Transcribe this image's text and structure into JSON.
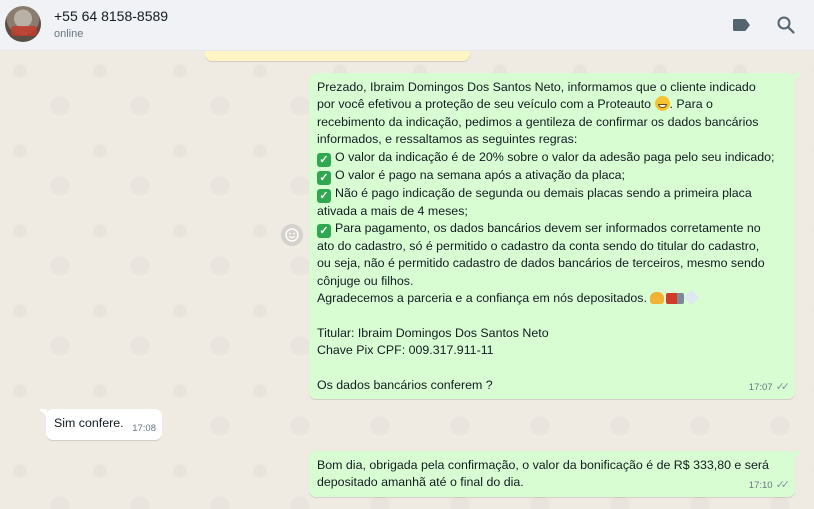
{
  "contact": {
    "name": "+55 64 8158-8589",
    "status": "online"
  },
  "header_icons": [
    "label-icon",
    "search-icon"
  ],
  "colors": {
    "outgoing_bubble": "#d9fdd3",
    "incoming_bubble": "#ffffff",
    "chat_background": "#efeae2",
    "header_background": "#f0f2f5",
    "check_emoji": "#2fa84f"
  },
  "messages": [
    {
      "direction": "outgoing",
      "time": "17:07",
      "lines": [
        "Prezado, Ibraim Domingos Dos Santos Neto, informamos que o cliente indicado",
        "por você efetivou a proteção de seu veículo com a Proteauto",
        ". Para o",
        "recebimento da indicação, pedimos a gentileza de confirmar os dados bancários",
        "informados, e  ressaltamos as seguintes regras:",
        "O valor da indicação é de 20% sobre o valor da adesão paga pelo seu indicado;",
        "O valor é pago na semana após a ativação da placa;",
        "Não é pago indicação de segunda ou demais placas sendo a primeira placa",
        "ativada a mais de 4 meses;",
        "Para pagamento, os dados bancários devem ser informados corretamente no",
        "ato do cadastro, só é permitido o cadastro da conta sendo do titular do cadastro,",
        "ou seja, não é permitido cadastro de dados bancários de terceiros, mesmo sendo",
        "cônjuge ou filhos.",
        "Agradecemos a parceria e a confiança em nós depositados.",
        "",
        "Titular: Ibraim Domingos Dos Santos Neto",
        "Chave Pix CPF: 009.317.911-11",
        "",
        "Os dados bancários conferem ?"
      ]
    },
    {
      "direction": "incoming",
      "time": "17:08",
      "text": "Sim confere."
    },
    {
      "direction": "outgoing",
      "time": "17:10",
      "lines": [
        "Bom dia, obrigada pela confirmação, o valor da bonificação é de R$ 333,80 e será",
        "depositado amanhã até o final do dia."
      ]
    }
  ]
}
